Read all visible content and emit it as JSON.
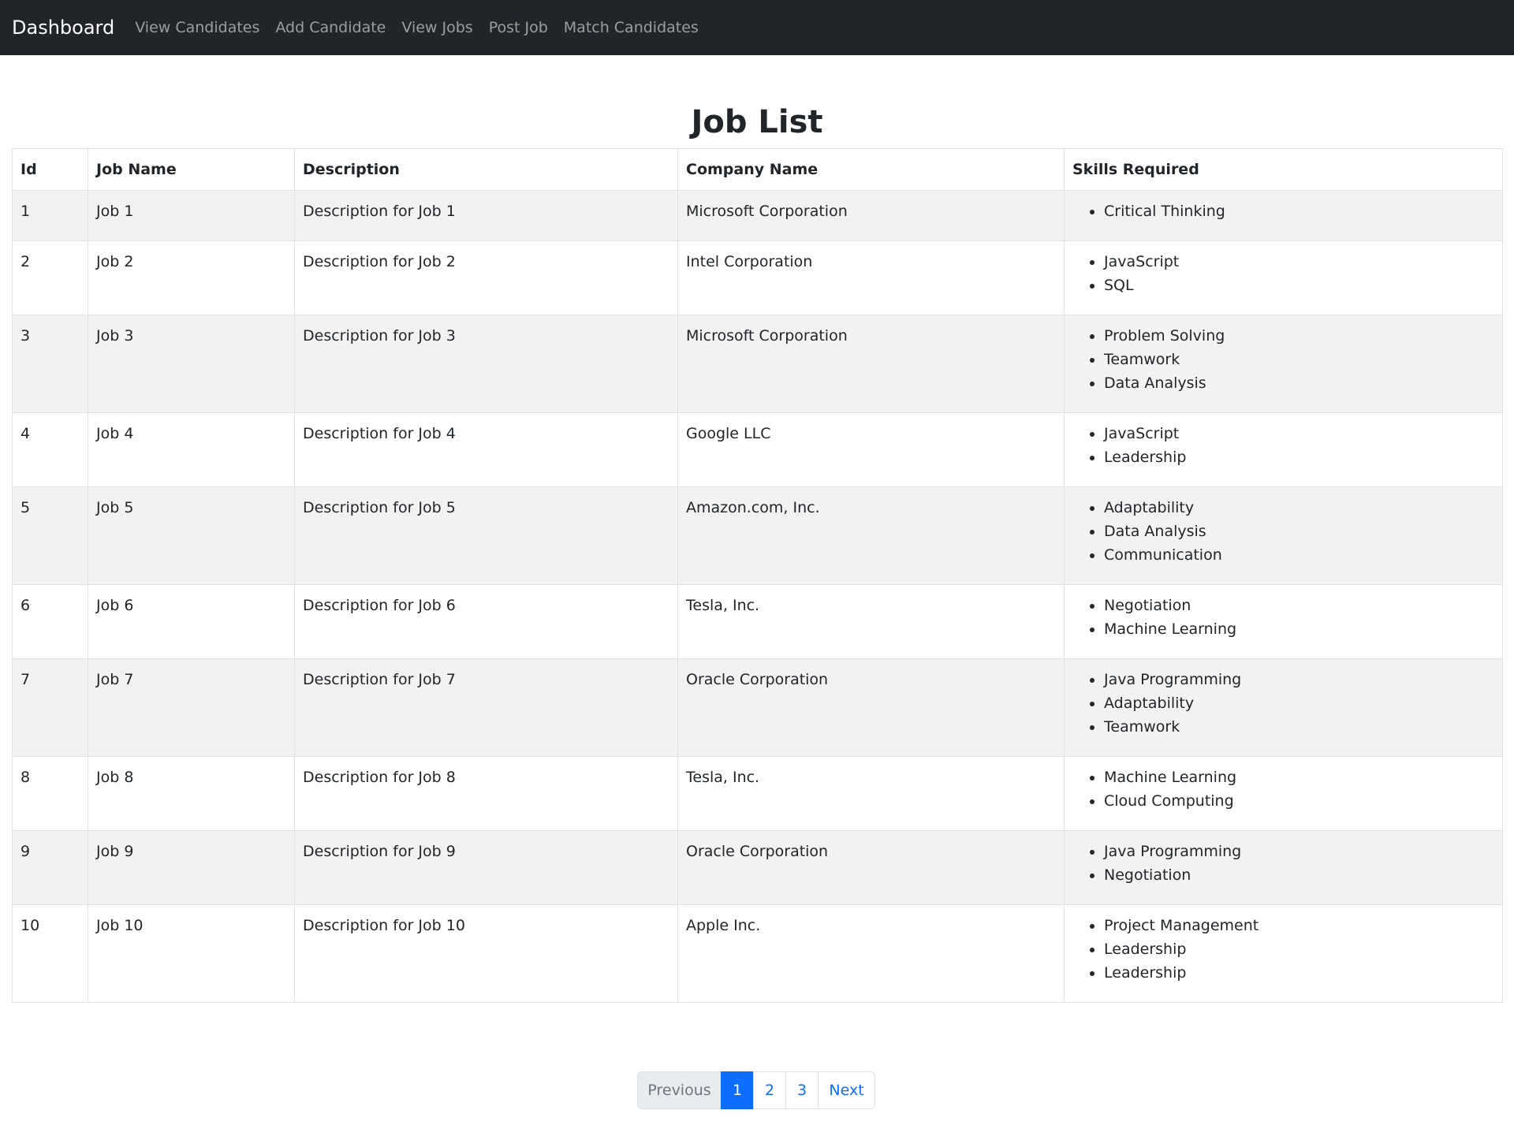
{
  "navbar": {
    "brand": "Dashboard",
    "links": [
      "View Candidates",
      "Add Candidate",
      "View Jobs",
      "Post Job",
      "Match Candidates"
    ]
  },
  "page_title": "Job List",
  "table": {
    "headers": [
      "Id",
      "Job Name",
      "Description",
      "Company Name",
      "Skills Required"
    ],
    "rows": [
      {
        "id": "1",
        "name": "Job 1",
        "description": "Description for Job 1",
        "company": "Microsoft Corporation",
        "skills": [
          "Critical Thinking"
        ]
      },
      {
        "id": "2",
        "name": "Job 2",
        "description": "Description for Job 2",
        "company": "Intel Corporation",
        "skills": [
          "JavaScript",
          "SQL"
        ]
      },
      {
        "id": "3",
        "name": "Job 3",
        "description": "Description for Job 3",
        "company": "Microsoft Corporation",
        "skills": [
          "Problem Solving",
          "Teamwork",
          "Data Analysis"
        ]
      },
      {
        "id": "4",
        "name": "Job 4",
        "description": "Description for Job 4",
        "company": "Google LLC",
        "skills": [
          "JavaScript",
          "Leadership"
        ]
      },
      {
        "id": "5",
        "name": "Job 5",
        "description": "Description for Job 5",
        "company": "Amazon.com, Inc.",
        "skills": [
          "Adaptability",
          "Data Analysis",
          "Communication"
        ]
      },
      {
        "id": "6",
        "name": "Job 6",
        "description": "Description for Job 6",
        "company": "Tesla, Inc.",
        "skills": [
          "Negotiation",
          "Machine Learning"
        ]
      },
      {
        "id": "7",
        "name": "Job 7",
        "description": "Description for Job 7",
        "company": "Oracle Corporation",
        "skills": [
          "Java Programming",
          "Adaptability",
          "Teamwork"
        ]
      },
      {
        "id": "8",
        "name": "Job 8",
        "description": "Description for Job 8",
        "company": "Tesla, Inc.",
        "skills": [
          "Machine Learning",
          "Cloud Computing"
        ]
      },
      {
        "id": "9",
        "name": "Job 9",
        "description": "Description for Job 9",
        "company": "Oracle Corporation",
        "skills": [
          "Java Programming",
          "Negotiation"
        ]
      },
      {
        "id": "10",
        "name": "Job 10",
        "description": "Description for Job 10",
        "company": "Apple Inc.",
        "skills": [
          "Project Management",
          "Leadership",
          "Leadership"
        ]
      }
    ]
  },
  "pagination": {
    "previous": "Previous",
    "pages": [
      "1",
      "2",
      "3"
    ],
    "active_page": "1",
    "next": "Next"
  },
  "colors": {
    "navbar_bg": "#212529",
    "striped_row": "#f2f2f2",
    "primary": "#0d6efd"
  }
}
